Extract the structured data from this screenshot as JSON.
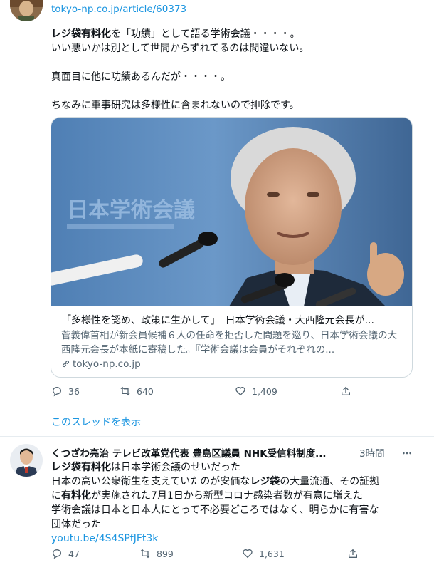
{
  "tweet1": {
    "link": "tokyo-np.co.jp/article/60373",
    "lines": [
      {
        "bold": "レジ袋有料化",
        "rest": "を「功績」として語る学術会議・・・・。"
      },
      {
        "bold": "",
        "rest": "いい悪いかは別として世間からずれてるのは間違いない。"
      },
      {
        "bold": "",
        "rest": "真面目に他に功績あるんだが・・・・。"
      },
      {
        "bold": "",
        "rest": "ちなみに軍事研究は多様性に含まれないので排除です。"
      }
    ],
    "card": {
      "image_caption": "日本学術会議",
      "title": "「多様性を認め、政策に生かして」　日本学術会議・大西隆元会長が...",
      "description": "菅義偉首相が新会員候補６人の任命を拒否した問題を巡り、日本学術会議の大西隆元会長が本紙に寄稿した。『学術会議は会員がそれぞれの...",
      "domain": "tokyo-np.co.jp"
    },
    "actions": {
      "reply": "36",
      "retweet": "640",
      "like": "1,409"
    }
  },
  "show_thread": "このスレッドを表示",
  "tweet2": {
    "author": "くつざわ亮治 テレビ改革党代表 豊島区議員 NHK受信料制度...",
    "time": "3時間",
    "line1_bold": "レジ袋有料化",
    "line1_rest": "は日本学術会議のせいだった",
    "line2_pre": "日本の高い公衆衛生を支えていたのが安価な",
    "line2_bold": "レジ袋",
    "line2_post": "の大量流通、その証拠",
    "line3_pre": "に",
    "line3_bold": "有料化",
    "line3_post": "が実施された7月1日から新型コロナ感染者数が有意に増えた",
    "line4": "学術会議は日本と日本人にとって不必要どころではなく、明らかに有害な",
    "line5": "団体だった",
    "link": "youtu.be/4S4SPfJFt3k",
    "actions": {
      "reply": "47",
      "retweet": "899",
      "like": "1,631"
    }
  },
  "colors": {
    "link": "#1b95e0",
    "secondary": "#536471",
    "border": "#cfd9de"
  }
}
